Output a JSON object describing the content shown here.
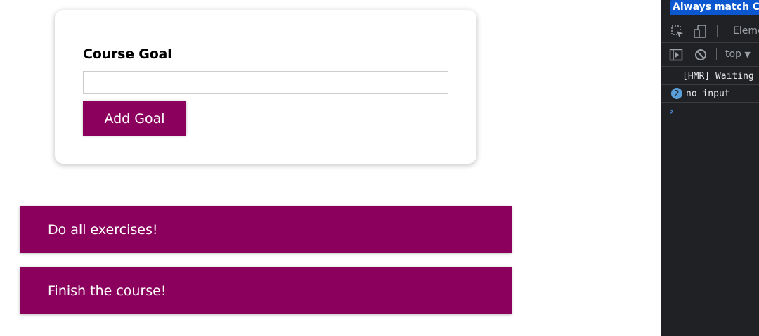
{
  "app": {
    "form": {
      "label": "Course Goal",
      "input_value": "",
      "button_label": "Add Goal"
    },
    "goals": [
      {
        "text": "Do all exercises!"
      },
      {
        "text": "Finish the course!"
      }
    ],
    "colors": {
      "accent": "#8b005d",
      "card_bg": "#ffffff",
      "input_border": "#cccccc"
    }
  },
  "devtools": {
    "infobar_button": "Always match Chrome's language",
    "toolbar": {
      "inspect_icon": "inspect-element-icon",
      "device_icon": "device-toolbar-icon",
      "elements_tab": "Elements"
    },
    "console_toolbar": {
      "sidebar_icon": "console-sidebar-icon",
      "clear_icon": "clear-console-icon",
      "context": "top"
    },
    "console_messages": [
      {
        "text": "[HMR] Waiting for update signal from WDS..."
      },
      {
        "count": "2",
        "text": "no input"
      }
    ],
    "prompt_icon": "chevron-right-icon",
    "colors": {
      "background": "#202124",
      "link_blue": "#0b57d0",
      "badge": "#5aa0d8"
    }
  }
}
